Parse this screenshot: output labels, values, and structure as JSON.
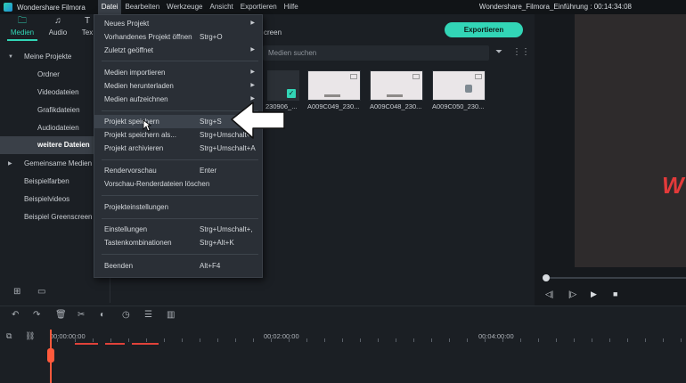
{
  "app": {
    "name": "Wondershare Filmora",
    "document_title": "Wondershare_Filmora_Einführung : 00:14:34:08"
  },
  "menubar": [
    "Datei",
    "Bearbeiten",
    "Werkzeuge",
    "Ansicht",
    "Exportieren",
    "Hilfe"
  ],
  "tabs": [
    {
      "label": "Medien",
      "icon": "folder-icon"
    },
    {
      "label": "Audio",
      "icon": "music-note-icon"
    },
    {
      "label": "Tex",
      "icon": "text-icon"
    }
  ],
  "tab_right_label": "creen",
  "export_button": "Exportieren",
  "sidebar": {
    "items": [
      {
        "label": "Meine Projekte",
        "expanded": true
      },
      {
        "label": "Ordner"
      },
      {
        "label": "Videodateien"
      },
      {
        "label": "Grafikdateien"
      },
      {
        "label": "Audiodateien"
      },
      {
        "label": "weitere Dateien",
        "selected": true
      },
      {
        "label": "Gemeinsame Medien",
        "expanded": false
      },
      {
        "label": "Beispielfarben"
      },
      {
        "label": "Beispielvideos"
      },
      {
        "label": "Beispiel Greenscreen"
      }
    ]
  },
  "search": {
    "placeholder": "Medien suchen"
  },
  "media": [
    {
      "label": "230906_..."
    },
    {
      "label": "A009C049_230..."
    },
    {
      "label": "A009C048_230..."
    },
    {
      "label": "A009C050_230..."
    }
  ],
  "preview": {
    "text": "W"
  },
  "timeline": {
    "timecodes": [
      "00:00:00:00",
      "00:02:00:00",
      "00:04:00:00"
    ]
  },
  "file_menu": {
    "items": [
      {
        "label": "Neues Projekt",
        "shortcut": "",
        "submenu": true
      },
      {
        "label": "Vorhandenes Projekt öffnen",
        "shortcut": "Strg+O"
      },
      {
        "label": "Zuletzt geöffnet",
        "shortcut": "",
        "submenu": true
      },
      {
        "label": "Medien importieren",
        "shortcut": "",
        "submenu": true
      },
      {
        "label": "Medien herunterladen",
        "shortcut": "",
        "submenu": true
      },
      {
        "label": "Medien aufzeichnen",
        "shortcut": "",
        "submenu": true
      },
      {
        "label": "Projekt speichern",
        "shortcut": "Strg+S",
        "highlighted": true
      },
      {
        "label": "Projekt speichern als...",
        "shortcut": "Strg+Umschalt+"
      },
      {
        "label": "Projekt archivieren",
        "shortcut": "Strg+Umschalt+A"
      },
      {
        "label": "Rendervorschau",
        "shortcut": "Enter"
      },
      {
        "label": "Vorschau-Renderdateien löschen",
        "shortcut": ""
      },
      {
        "label": "Projekteinstellungen",
        "shortcut": ""
      },
      {
        "label": "Einstellungen",
        "shortcut": "Strg+Umschalt+,"
      },
      {
        "label": "Tastenkombinationen",
        "shortcut": "Strg+Alt+K"
      },
      {
        "label": "Beenden",
        "shortcut": "Alt+F4"
      }
    ]
  },
  "colors": {
    "accent": "#32d5b6",
    "playhead": "#ff5a3c",
    "menu_bg": "#2a2f36"
  }
}
